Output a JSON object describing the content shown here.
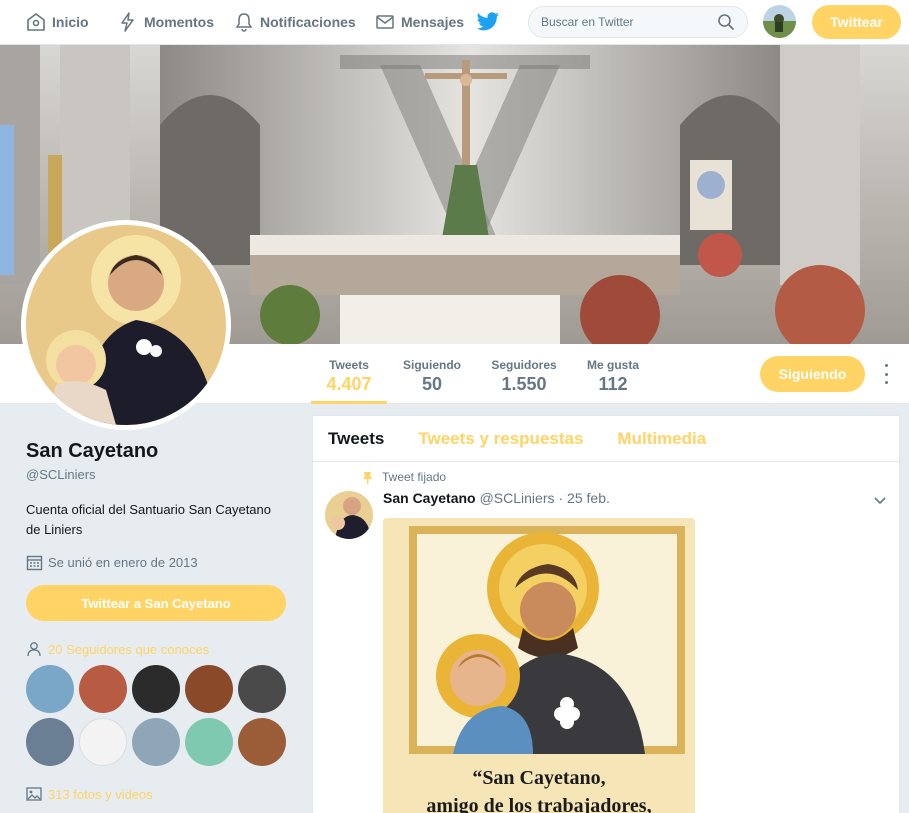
{
  "nav": {
    "home": "Inicio",
    "moments": "Momentos",
    "notifications": "Notificaciones",
    "messages": "Mensajes",
    "search_placeholder": "Buscar en Twitter",
    "tweet_button": "Twittear"
  },
  "profile": {
    "name": "San Cayetano",
    "handle": "@SCLiniers",
    "bio": "Cuenta oficial del Santuario San Cayetano de Liniers",
    "joined": "Se unió en enero de 2013",
    "tweet_to_button": "Twittear a San Cayetano",
    "followers_you_know": "20 Seguidores que conoces",
    "photos_videos": "313 fotos y videos"
  },
  "stats": [
    {
      "label": "Tweets",
      "value": "4.407"
    },
    {
      "label": "Siguiendo",
      "value": "50"
    },
    {
      "label": "Seguidores",
      "value": "1.550"
    },
    {
      "label": "Me gusta",
      "value": "112"
    }
  ],
  "following_button": "Siguiendo",
  "timeline": {
    "tabs": [
      "Tweets",
      "Tweets y respuestas",
      "Multimedia"
    ],
    "pinned_label": "Tweet fijado",
    "tweet": {
      "author": "San Cayetano",
      "handle": "@SCLiniers",
      "date": "· 25 feb.",
      "image_quote_line1": "“San Cayetano,",
      "image_quote_line2": "amigo de los trabajadores,"
    }
  },
  "colors": {
    "accent": "#ffd464",
    "text": "#14171a",
    "muted": "#657786",
    "background": "#e6ecf0",
    "twitter_blue": "#1da1f2"
  },
  "icons": [
    "home-icon",
    "lightning-icon",
    "bell-icon",
    "envelope-icon",
    "twitter-bird-icon",
    "search-icon",
    "calendar-icon",
    "person-icon",
    "image-icon",
    "pin-icon",
    "chevron-down-icon",
    "more-icon"
  ]
}
